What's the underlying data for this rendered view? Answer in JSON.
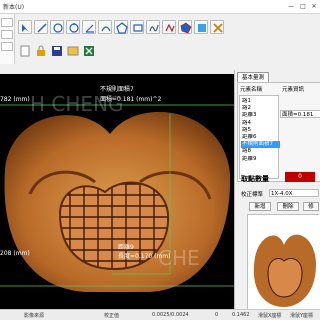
{
  "window": {
    "title": "新本(U)",
    "min_glyph": "—",
    "max_glyph": "□",
    "close_glyph": "✕"
  },
  "viewer": {
    "watermark_top": "H CHENG",
    "watermark_bottom": "CHE",
    "annotations": [
      {
        "text": "782 (mm)"
      },
      {
        "text": "不規則面積7"
      },
      {
        "text": "面積=0.181 (mm)^2"
      },
      {
        "text": "208 (mm)"
      },
      {
        "text": "距離9"
      },
      {
        "text": "長度=0.170 (mm)"
      }
    ]
  },
  "side": {
    "tab_label": "基本量測",
    "col_name_header": "元素名稱",
    "col_info_header": "元素資訊",
    "items": [
      "路1",
      "路2",
      "距離3",
      "路4",
      "路5",
      "距離6",
      "不規則面積7",
      "路8",
      "距離9"
    ],
    "selected_index": 6,
    "info_value": "面積=0.181",
    "count_label": "取點數量",
    "count_value": "0",
    "calib_label": "校正標準",
    "calib_value": "1X-4.0X",
    "btn_add": "新增",
    "btn_delete": "刪除",
    "btn_more": "修"
  },
  "status": {
    "left": "影像來源",
    "mid1": "校正值",
    "mid2": "0.0025/0.0024",
    "mid3": "0",
    "mid4": "0.1462",
    "right": "滑鼠X座標",
    "right2": "滑鼠Y座標"
  },
  "colors": {
    "accent": "#3399ff",
    "count_bg": "#c00000",
    "toolbar_icon_blue": "#2060c0"
  }
}
